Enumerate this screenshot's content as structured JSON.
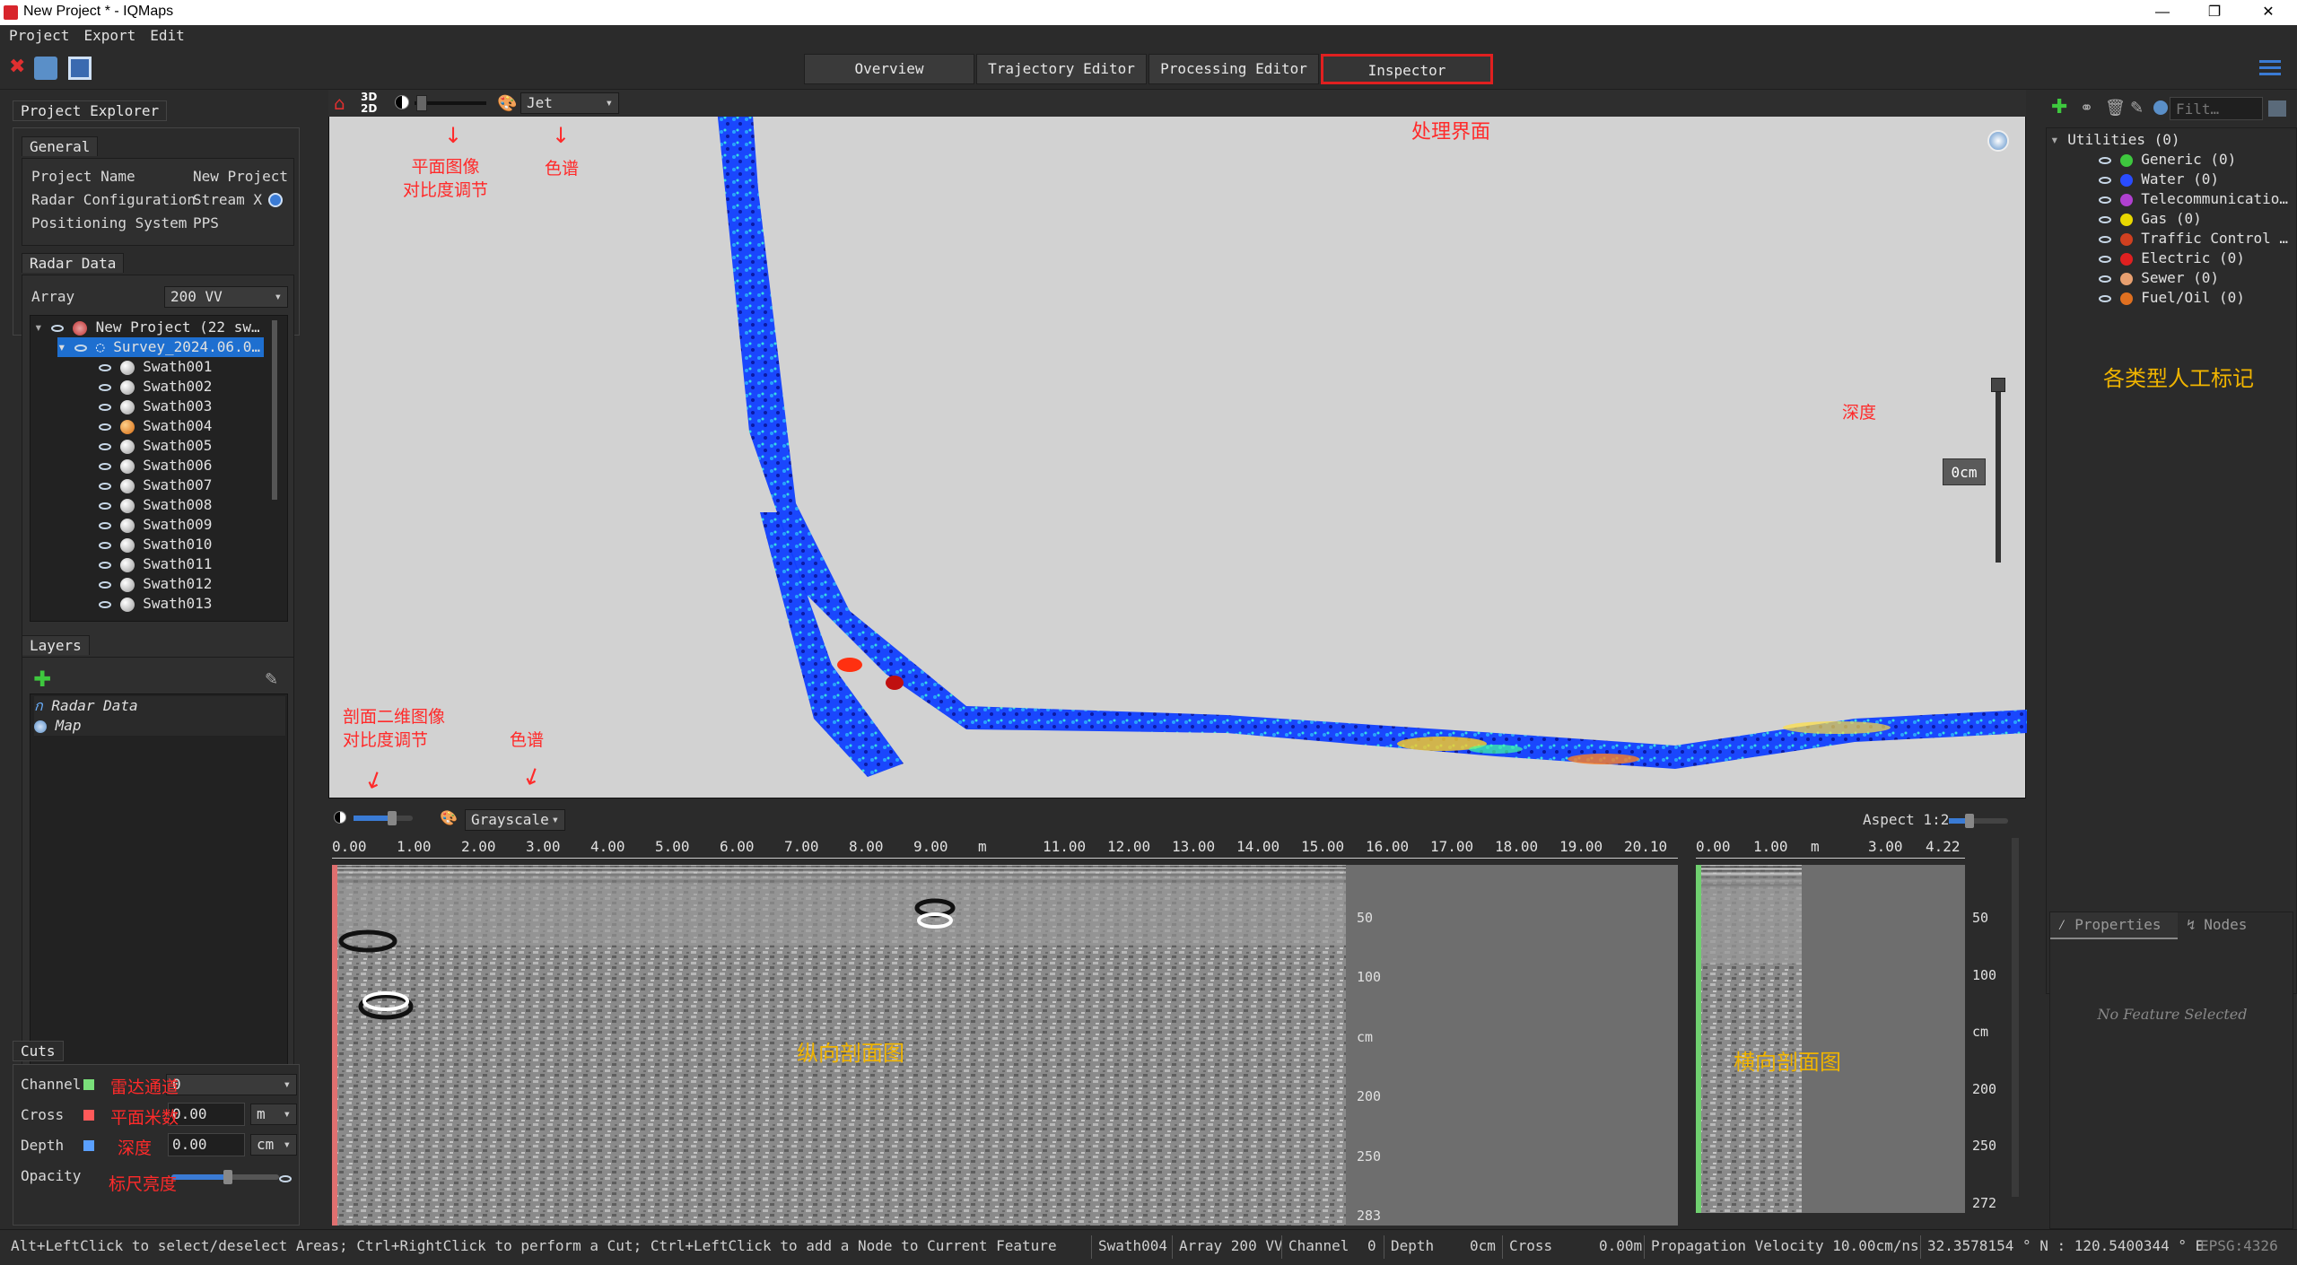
{
  "window": {
    "title": "New Project * - IQMaps",
    "minimize": "—",
    "maximize": "❐",
    "close": "✕"
  },
  "menu": [
    "Project",
    "Export",
    "Edit"
  ],
  "tabs": [
    {
      "label": "Overview"
    },
    {
      "label": "Trajectory Editor"
    },
    {
      "label": "Processing Editor"
    },
    {
      "label": "Inspector",
      "active": true
    }
  ],
  "left": {
    "project_explorer": "Project Explorer",
    "general": {
      "title": "General",
      "rows": [
        {
          "k": "Project Name",
          "v": "New Project"
        },
        {
          "k": "Radar Configuration",
          "v": "Stream X"
        },
        {
          "k": "Positioning System",
          "v": "PPS"
        }
      ]
    },
    "radar_data": {
      "title": "Radar Data",
      "array_label": "Array",
      "array_value": "200 VV",
      "root": "New Project (22 sw…",
      "survey": "Survey_2024.06.0…",
      "swaths": [
        "Swath001",
        "Swath002",
        "Swath003",
        "Swath004",
        "Swath005",
        "Swath006",
        "Swath007",
        "Swath008",
        "Swath009",
        "Swath010",
        "Swath011",
        "Swath012",
        "Swath013"
      ],
      "highlight_index": 3
    },
    "layers": {
      "title": "Layers",
      "items": [
        "Radar Data",
        "Map"
      ]
    },
    "cuts": {
      "title": "Cuts",
      "channel_label": "Channel",
      "channel_value": "0",
      "cross_label": "Cross",
      "cross_value": "0.00",
      "cross_unit": "m",
      "depth_label": "Depth",
      "depth_value": "0.00",
      "depth_unit": "cm",
      "opacity_label": "Opacity",
      "ann_channel": "雷达通道",
      "ann_cross": "平面米数",
      "ann_depth": "深度",
      "ann_opacity": "标尺亮度"
    }
  },
  "map": {
    "colormap": "Jet",
    "view_mode": "3D 2D",
    "ann_contrast": "平面图像\n对比度调节",
    "ann_colormap": "色谱",
    "ann_title": "处理界面",
    "ann_depth": "深度",
    "depth_value": "0cm"
  },
  "profiles": {
    "colormap": "Grayscale",
    "aspect": "Aspect 1:2",
    "ann_contrast": "剖面二维图像\n对比度调节",
    "ann_colormap": "色谱",
    "ann_long": "纵向剖面图",
    "ann_cross": "横向剖面图",
    "long_ticks": [
      "0.00",
      "1.00",
      "2.00",
      "3.00",
      "4.00",
      "5.00",
      "6.00",
      "7.00",
      "8.00",
      "9.00",
      "m",
      "11.00",
      "12.00",
      "13.00",
      "14.00",
      "15.00",
      "16.00",
      "17.00",
      "18.00",
      "19.00",
      "20.10"
    ],
    "cross_ticks": [
      "0.00",
      "1.00",
      "m",
      "3.00",
      "4.22"
    ],
    "depth_ticks_long": [
      "50",
      "100",
      "cm",
      "200",
      "250",
      "283"
    ],
    "depth_ticks_cross": [
      "50",
      "100",
      "cm",
      "200",
      "250",
      "272"
    ]
  },
  "right": {
    "filter_placeholder": "Filt…",
    "utilities": "Utilities (0)",
    "items": [
      {
        "label": "Generic (0)",
        "color": "#3ec83e"
      },
      {
        "label": "Water (0)",
        "color": "#2a4cff"
      },
      {
        "label": "Telecommunicatio…",
        "color": "#b040d0"
      },
      {
        "label": "Gas (0)",
        "color": "#e8d800"
      },
      {
        "label": "Traffic Control …",
        "color": "#d04020"
      },
      {
        "label": "Electric (0)",
        "color": "#e02020"
      },
      {
        "label": "Sewer (0)",
        "color": "#e8a070"
      },
      {
        "label": "Fuel/Oil (0)",
        "color": "#e07020"
      }
    ],
    "ann": "各类型人工标记",
    "properties_tab": "Properties",
    "nodes_tab": "Nodes",
    "no_feature": "No Feature Selected"
  },
  "status": {
    "hint": "Alt+LeftClick to select/deselect Areas; Ctrl+RightClick to perform a Cut; Ctrl+LeftClick to add a Node to Current Feature",
    "swath": "Swath004",
    "array": "Array 200 VV",
    "channel": "Channel",
    "channel_v": "0",
    "depth": "Depth",
    "depth_v": "0cm",
    "cross": "Cross",
    "cross_v": "0.00m",
    "velocity": "Propagation Velocity 10.00cm/ns",
    "coords": "32.3578154 ° N : 120.5400344 ° E",
    "epsg": "EPSG:4326"
  }
}
